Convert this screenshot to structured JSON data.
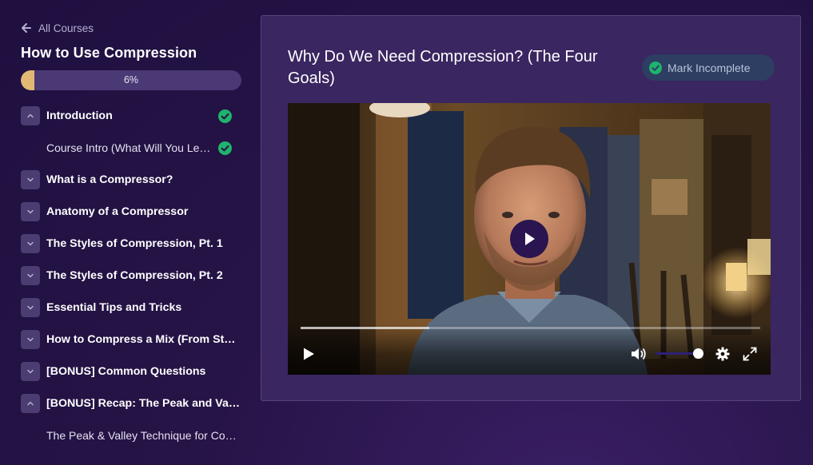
{
  "sidebar": {
    "back_label": "All Courses",
    "course_title": "How to Use Compression",
    "progress": {
      "percent": 6,
      "label": "6%"
    },
    "accent_color": "#e2b873",
    "check_color": "#1fb36b",
    "modules": [
      {
        "label": "Introduction",
        "expanded": true,
        "completed": true,
        "lessons": [
          {
            "label": "Course Intro (What Will You Learn?)",
            "completed": true
          }
        ]
      },
      {
        "label": "What is a Compressor?",
        "expanded": false,
        "completed": false,
        "lessons": []
      },
      {
        "label": "Anatomy of a Compressor",
        "expanded": false,
        "completed": false,
        "lessons": []
      },
      {
        "label": "The Styles of Compression, Pt. 1",
        "expanded": false,
        "completed": false,
        "lessons": []
      },
      {
        "label": "The Styles of Compression, Pt. 2",
        "expanded": false,
        "completed": false,
        "lessons": []
      },
      {
        "label": "Essential Tips and Tricks",
        "expanded": false,
        "completed": false,
        "lessons": []
      },
      {
        "label": "How to Compress a Mix (From Start to Finish)",
        "expanded": false,
        "completed": false,
        "lessons": []
      },
      {
        "label": "[BONUS] Common Questions",
        "expanded": false,
        "completed": false,
        "lessons": []
      },
      {
        "label": "[BONUS] Recap: The Peak and Valley Technique",
        "expanded": true,
        "completed": false,
        "lessons": [
          {
            "label": "The Peak & Valley Technique for Compression",
            "completed": false
          }
        ]
      }
    ]
  },
  "main": {
    "lesson_title": "Why Do We Need Compression? (The Four Goals)",
    "mark_button_label": "Mark Incomplete",
    "video": {
      "playback_progress": 0,
      "buffered_fraction": 0.28,
      "volume": 0.95,
      "controls": [
        "play-icon",
        "volume-icon",
        "settings-icon",
        "fullscreen-icon"
      ]
    }
  }
}
